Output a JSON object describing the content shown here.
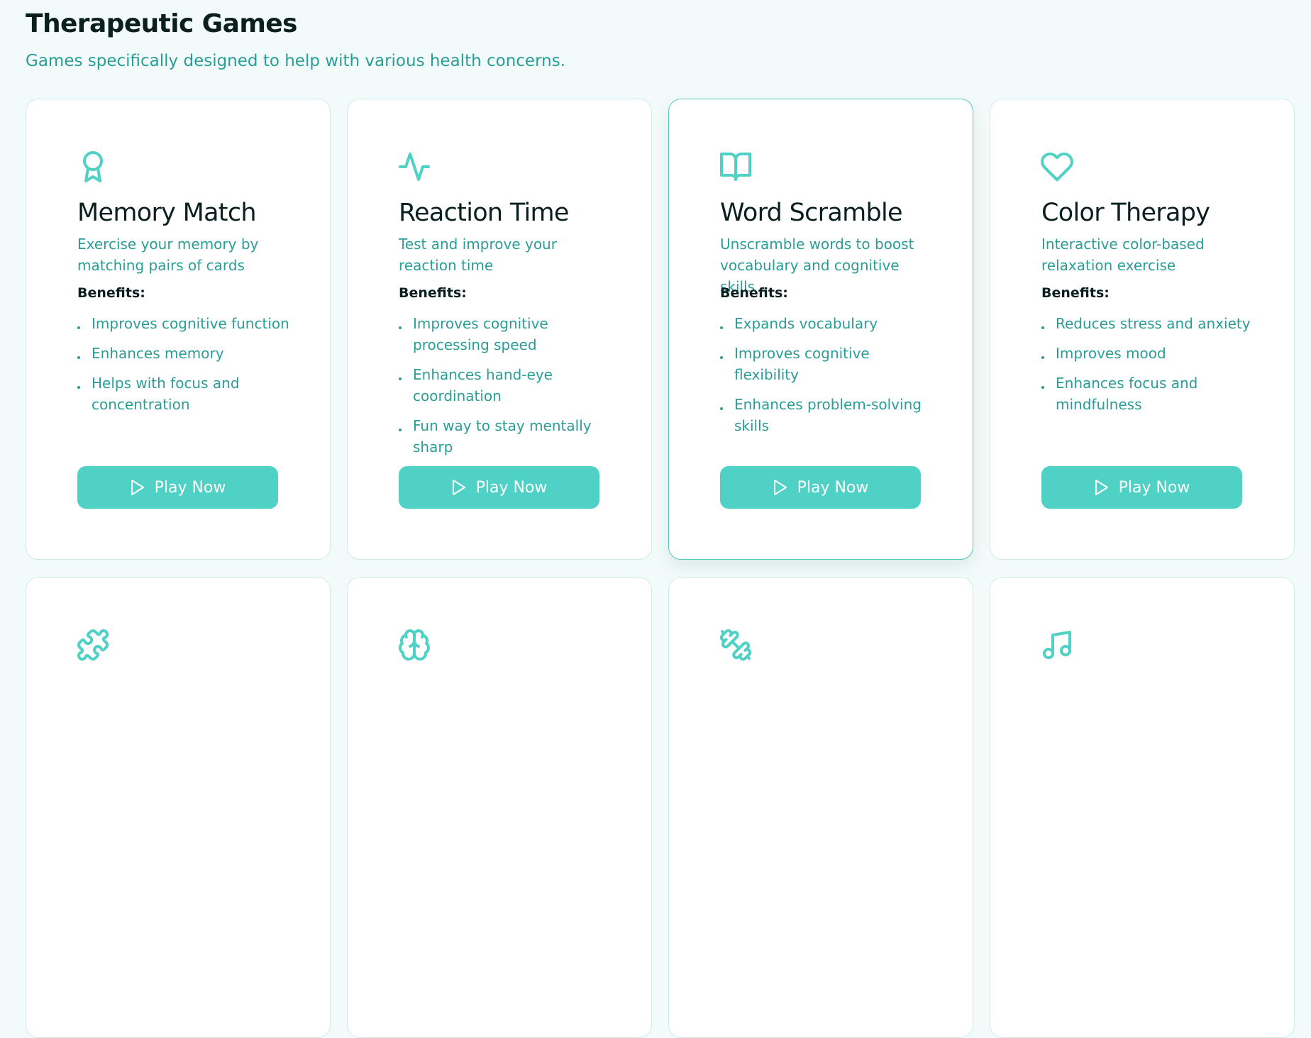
{
  "header": {
    "title": "Therapeutic Games",
    "subtitle": "Games specifically designed to help with various health concerns."
  },
  "colors": {
    "accent": "#4fd1c5",
    "accent_text": "#2a9d96",
    "heading": "#0b1f1f",
    "background": "#f3fbfa"
  },
  "cards": [
    {
      "icon": "award-icon",
      "title": "Memory Match",
      "description": "Exercise your memory by matching pairs of cards",
      "benefits_label": "Benefits:",
      "benefits": [
        "Improves cognitive function",
        "Enhances memory",
        "Helps with focus and concentration"
      ],
      "button_label": "Play Now"
    },
    {
      "icon": "activity-icon",
      "title": "Reaction Time",
      "description": "Test and improve your reaction time",
      "benefits_label": "Benefits:",
      "benefits": [
        "Improves cognitive processing speed",
        "Enhances hand-eye coordination",
        "Fun way to stay mentally sharp"
      ],
      "button_label": "Play Now"
    },
    {
      "icon": "book-open-icon",
      "title": "Word Scramble",
      "description": "Unscramble words to boost vocabulary and cognitive skills",
      "benefits_label": "Benefits:",
      "benefits": [
        "Expands vocabulary",
        "Improves cognitive flexibility",
        "Enhances problem-solving skills"
      ],
      "button_label": "Play Now"
    },
    {
      "icon": "heart-icon",
      "title": "Color Therapy",
      "description": "Interactive color-based relaxation exercise",
      "benefits_label": "Benefits:",
      "benefits": [
        "Reduces stress and anxiety",
        "Improves mood",
        "Enhances focus and mindfulness"
      ],
      "button_label": "Play Now"
    },
    {
      "icon": "puzzle-icon"
    },
    {
      "icon": "brain-icon"
    },
    {
      "icon": "dumbbell-icon"
    },
    {
      "icon": "music-icon"
    }
  ]
}
